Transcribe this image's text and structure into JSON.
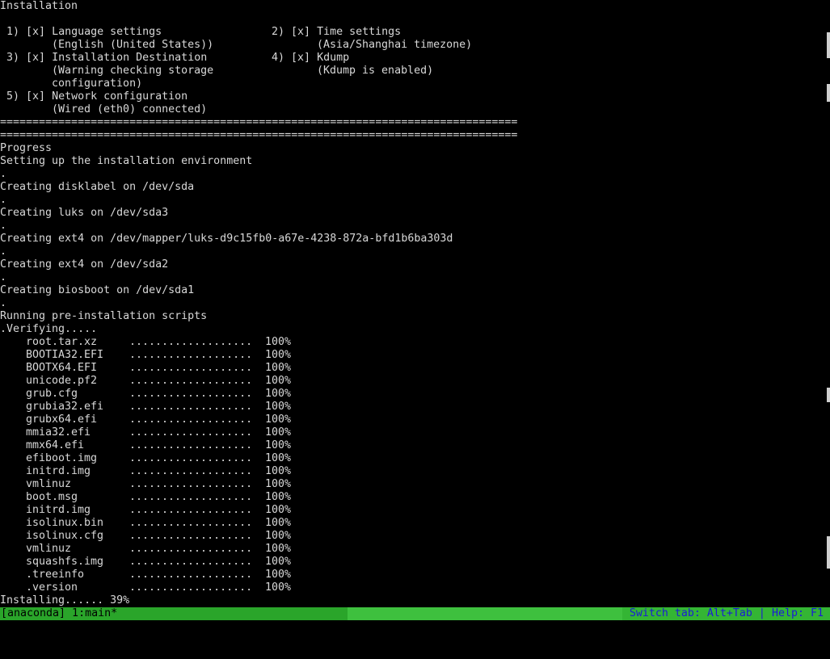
{
  "header": {
    "title": "Installation"
  },
  "spokes": [
    {
      "num": "1)",
      "mark": "[x]",
      "title": "Language settings",
      "detail": [
        "(English (United States))"
      ]
    },
    {
      "num": "2)",
      "mark": "[x]",
      "title": "Time settings",
      "detail": [
        "(Asia/Shanghai timezone)"
      ]
    },
    {
      "num": "3)",
      "mark": "[x]",
      "title": "Installation Destination",
      "detail": [
        "(Warning checking storage",
        "configuration)"
      ]
    },
    {
      "num": "4)",
      "mark": "[x]",
      "title": "Kdump",
      "detail": [
        "(Kdump is enabled)"
      ]
    },
    {
      "num": "5)",
      "mark": "[x]",
      "title": "Network configuration",
      "detail": [
        "(Wired (eth0) connected)"
      ]
    }
  ],
  "separator": "================================================================================",
  "progress": {
    "heading": "Progress",
    "steps": [
      "Setting up the installation environment",
      ".",
      "Creating disklabel on /dev/sda",
      ".",
      "Creating luks on /dev/sda3",
      ".",
      "Creating ext4 on /dev/mapper/luks-d9c15fb0-a67e-4238-872a-bfd1b6ba303d",
      ".",
      "Creating ext4 on /dev/sda2",
      ".",
      "Creating biosboot on /dev/sda1",
      ".",
      "Running pre-installation scripts",
      ".Verifying....."
    ],
    "files": [
      {
        "name": "root.tar.xz",
        "dots": "...................",
        "pct": "100%"
      },
      {
        "name": "BOOTIA32.EFI",
        "dots": "...................",
        "pct": "100%"
      },
      {
        "name": "BOOTX64.EFI",
        "dots": "...................",
        "pct": "100%"
      },
      {
        "name": "unicode.pf2",
        "dots": "...................",
        "pct": "100%"
      },
      {
        "name": "grub.cfg",
        "dots": "...................",
        "pct": "100%"
      },
      {
        "name": "grubia32.efi",
        "dots": "...................",
        "pct": "100%"
      },
      {
        "name": "grubx64.efi",
        "dots": "...................",
        "pct": "100%"
      },
      {
        "name": "mmia32.efi",
        "dots": "...................",
        "pct": "100%"
      },
      {
        "name": "mmx64.efi",
        "dots": "...................",
        "pct": "100%"
      },
      {
        "name": "efiboot.img",
        "dots": "...................",
        "pct": "100%"
      },
      {
        "name": "initrd.img",
        "dots": "...................",
        "pct": "100%"
      },
      {
        "name": "vmlinuz",
        "dots": "...................",
        "pct": "100%"
      },
      {
        "name": "boot.msg",
        "dots": "...................",
        "pct": "100%"
      },
      {
        "name": "initrd.img",
        "dots": "...................",
        "pct": "100%"
      },
      {
        "name": "isolinux.bin",
        "dots": "...................",
        "pct": "100%"
      },
      {
        "name": "isolinux.cfg",
        "dots": "...................",
        "pct": "100%"
      },
      {
        "name": "vmlinuz",
        "dots": "...................",
        "pct": "100%"
      },
      {
        "name": "squashfs.img",
        "dots": "...................",
        "pct": "100%"
      },
      {
        "name": ".treeinfo",
        "dots": "...................",
        "pct": "100%"
      },
      {
        "name": ".version",
        "dots": "...................",
        "pct": "100%"
      }
    ],
    "installing": "Installing...... 39%"
  },
  "status_bar": {
    "session": "[anaconda] 1:main*",
    "help": "Switch tab: Alt+Tab | Help: F1"
  },
  "colors": {
    "background": "#000000",
    "text": "#d8d8d8",
    "status_green": "#2aa52a",
    "status_help_text": "#1a1ad8"
  }
}
